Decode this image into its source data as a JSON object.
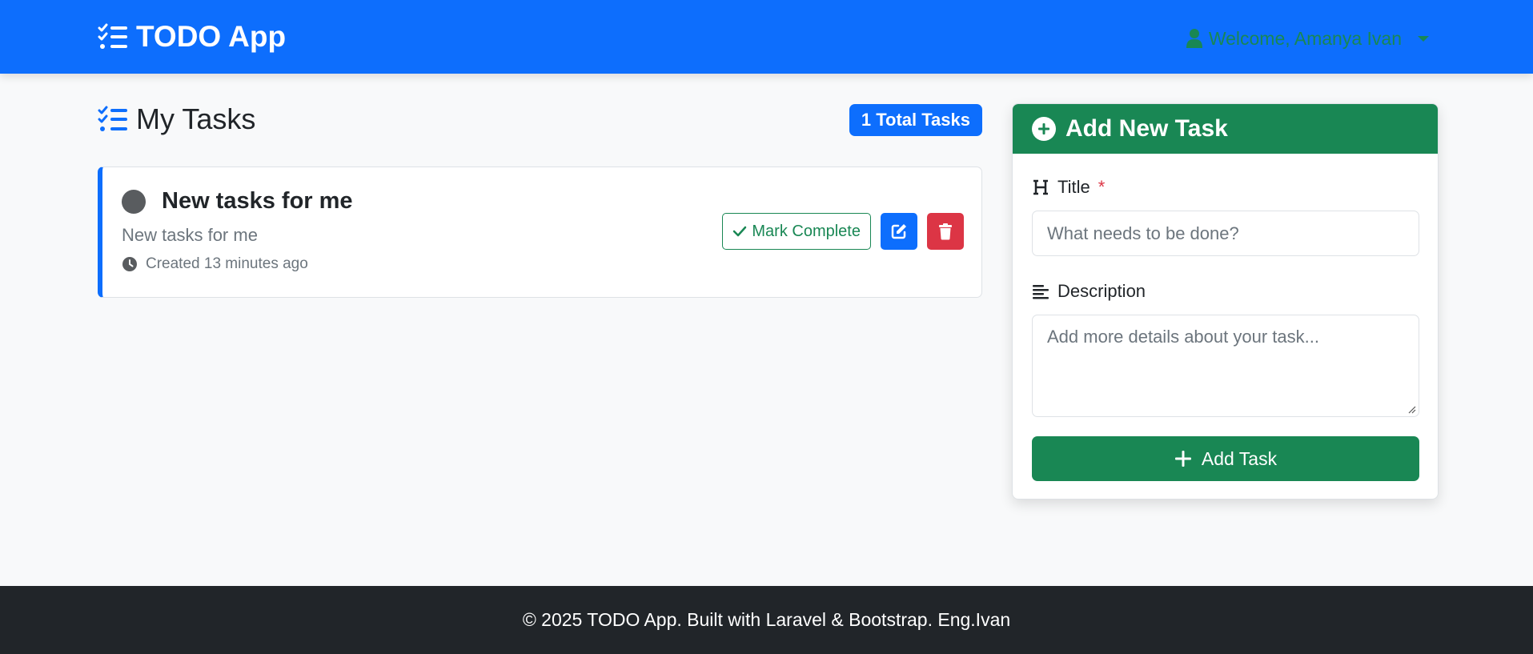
{
  "navbar": {
    "brand": "TODO App",
    "brand_icon": "tasks-list-icon",
    "user_greeting": "Welcome, Amanya Ivan",
    "user_icon": "user-icon"
  },
  "tasks_section": {
    "heading": "My Tasks",
    "heading_icon": "tasks-list-icon",
    "total_badge": "1 Total Tasks",
    "tasks": [
      {
        "title": "New tasks for me",
        "description": "New tasks for me",
        "created": "Created 13 minutes ago",
        "complete_label": "Mark Complete"
      }
    ]
  },
  "add_task": {
    "header": "Add New Task",
    "title_label": "Title",
    "required_marker": "*",
    "title_placeholder": "What needs to be done?",
    "description_label": "Description",
    "description_placeholder": "Add more details about your task...",
    "submit_label": "Add Task"
  },
  "footer": {
    "text": "© 2025 TODO App. Built with Laravel & Bootstrap. Eng.Ivan"
  },
  "colors": {
    "primary": "#0d6efd",
    "success": "#198754",
    "danger": "#dc3545",
    "dark": "#212529",
    "background": "#f8f9fa"
  }
}
